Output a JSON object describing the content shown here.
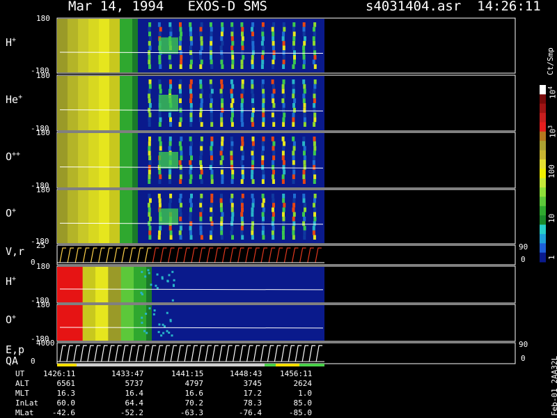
{
  "header": {
    "title": "Mar 14, 1994   EXOS-D SMS",
    "file": "s4031404.asr  14:26:11"
  },
  "chart_data": {
    "type": "heatmap",
    "title": "Mar 14, 1994   EXOS-D SMS",
    "panels": [
      {
        "label": "H",
        "sup": "+",
        "ymin": "-180",
        "ymax": "180"
      },
      {
        "label": "He",
        "sup": "+",
        "ymin": "-180",
        "ymax": "180"
      },
      {
        "label": "O",
        "sup": "++",
        "ymin": "-180",
        "ymax": "180"
      },
      {
        "label": "O",
        "sup": "+",
        "ymin": "-180",
        "ymax": "180"
      },
      {
        "label": "V,r",
        "sup": "",
        "ymin": "0",
        "ymax": "25",
        "right_top": "90",
        "right_bottom": "0"
      },
      {
        "label": "H",
        "sup": "+",
        "ymin": "-180",
        "ymax": "180"
      },
      {
        "label": "O",
        "sup": "+",
        "ymin": "-180",
        "ymax": "180"
      },
      {
        "label": "E,p",
        "label2": "QA",
        "ymin": "0",
        "ymax": "4000",
        "right_top": "90",
        "right_bottom": "0"
      }
    ],
    "colorbar": {
      "unit": "Ct/Smp",
      "ticks": [
        "1",
        "10",
        "100",
        "10",
        "10"
      ],
      "tick_exps": [
        "",
        "",
        "",
        "3",
        "4"
      ],
      "colors": [
        "#0a1a8c",
        "#1e5fd8",
        "#1fa0d8",
        "#28d0c8",
        "#1a8a2a",
        "#2fa82f",
        "#5cc83a",
        "#8ee03a",
        "#c4e83a",
        "#f0f000",
        "#e6e032",
        "#c8b432",
        "#aaa032",
        "#b4781e",
        "#e61e1e",
        "#c81e1e",
        "#a01414",
        "#7a0a0a",
        "#ffffff"
      ]
    },
    "time_axis": {
      "rows": [
        {
          "name": "UT",
          "values": [
            "1426:11",
            "1433:47",
            "1441:15",
            "1448:43",
            "1456:11"
          ]
        },
        {
          "name": "ALT",
          "values": [
            "6561",
            "5737",
            "4797",
            "3745",
            "2624"
          ]
        },
        {
          "name": "MLT",
          "values": [
            "16.3",
            "16.4",
            "16.6",
            "17.2",
            "1.0"
          ]
        },
        {
          "name": "InLat",
          "values": [
            "60.0",
            "64.4",
            "70.2",
            "78.3",
            "85.0"
          ]
        },
        {
          "name": "MLat",
          "values": [
            "-42.6",
            "-52.2",
            "-63.3",
            "-76.4",
            "-85.0"
          ]
        }
      ]
    }
  },
  "footer": {
    "stamp": "Feb-01 2AA32L"
  }
}
